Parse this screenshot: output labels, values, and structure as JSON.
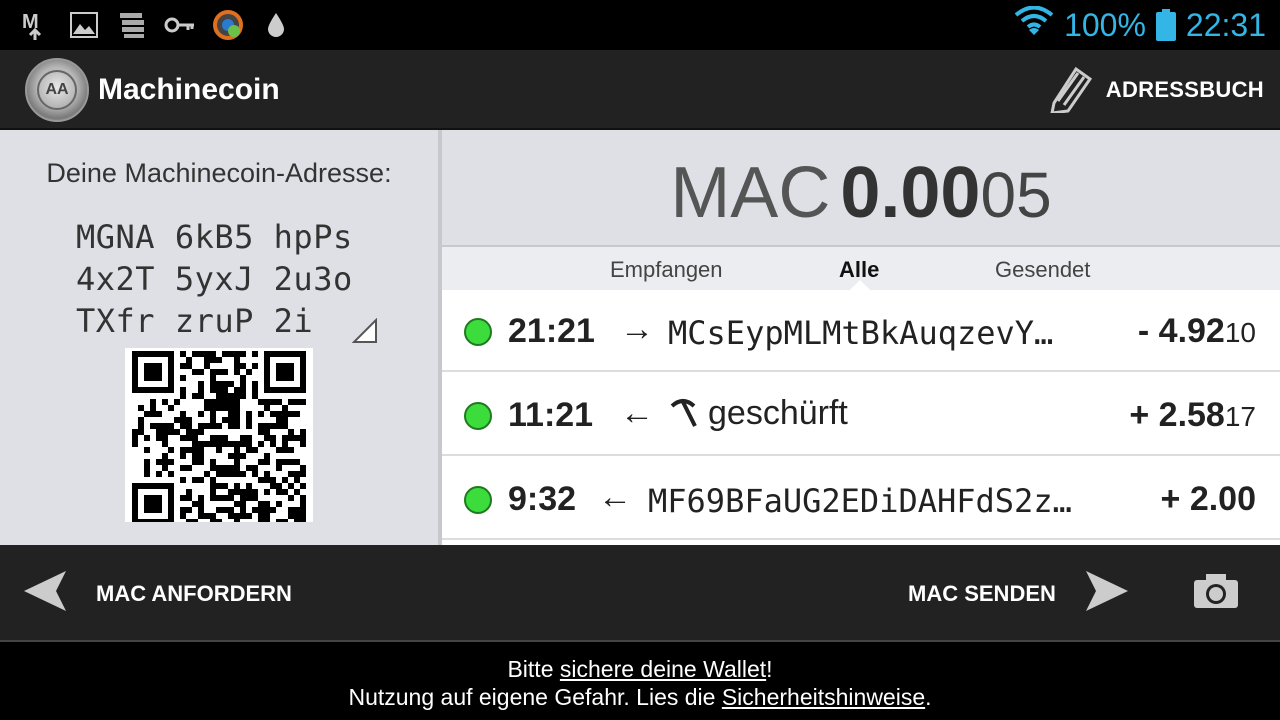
{
  "status_bar": {
    "battery": "100%",
    "time": "22:31"
  },
  "action_bar": {
    "title": "Machinecoin",
    "address_book_label": "ADRESSBUCH"
  },
  "address_panel": {
    "label": "Deine Machinecoin-Adresse:",
    "address_lines": [
      "MGNA 6kB5 hpPs",
      "4x2T 5yxJ 2u3o",
      "TXfr zruP 2i"
    ]
  },
  "balance": {
    "currency": "MAC",
    "main": "0.00",
    "small": "05"
  },
  "tabs": {
    "received": "Empfangen",
    "all": "Alle",
    "sent": "Gesendet"
  },
  "transactions": [
    {
      "time": "21:21",
      "arrow": "→",
      "party": "MCsEypMLMtBkAuqzevY…",
      "amount_main": "- 4.92",
      "amount_small": "10"
    },
    {
      "time": "11:21",
      "arrow": "←",
      "party": "geschürft",
      "amount_main": "+ 2.58",
      "amount_small": "17"
    },
    {
      "time": "9:32",
      "arrow": "←",
      "party": "MF69BFaUG2EDiDAHFdS2z…",
      "amount_main": "+ 2.00",
      "amount_small": ""
    }
  ],
  "bottom_bar": {
    "request_label": "MAC ANFORDERN",
    "send_label": "MAC SENDEN"
  },
  "footer": {
    "line1_prefix": "Bitte ",
    "line1_link": "sichere deine Wallet",
    "line1_suffix": "!",
    "line2_prefix": "Nutzung auf eigene Gefahr. Lies die ",
    "line2_link": "Sicherheitshinweise",
    "line2_suffix": "."
  },
  "colors": {
    "status_accent": "#33b5e5",
    "tx_confirmed": "#3ddc3d"
  },
  "icons": [
    "gmail-icon",
    "gallery-icon",
    "stack-icon",
    "key-icon",
    "mining-app-icon",
    "drop-icon",
    "wifi-icon",
    "battery-icon",
    "pencil-icon",
    "send-arrow-left-icon",
    "send-arrow-right-icon",
    "camera-icon",
    "pickaxe-icon"
  ]
}
